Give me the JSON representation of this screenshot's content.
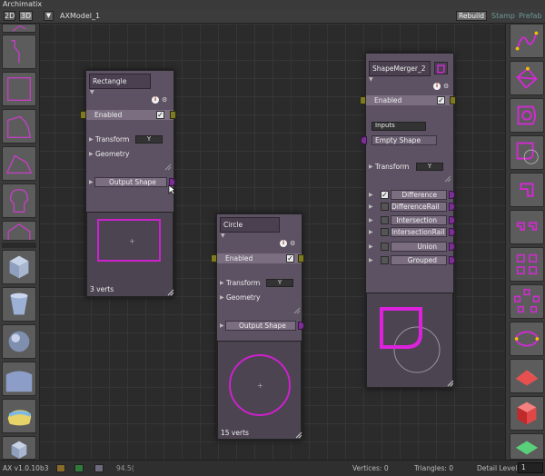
{
  "window_title": "Archimatix",
  "toolbar": {
    "btn_2d": "2D",
    "btn_3d": "3D",
    "dropdown_arrow": "▼",
    "model_name": "AXModel_1",
    "rebuild": "Rebuild",
    "stamp": "Stamp",
    "prefab": "Prefab"
  },
  "nodes": {
    "rectangle": {
      "title": "Rectangle",
      "enabled": "Enabled",
      "transform": "Transform",
      "transform_sel": "Y",
      "geometry": "Geometry",
      "output": "Output Shape",
      "verts": "3 verts"
    },
    "circle": {
      "title": "Circle",
      "enabled": "Enabled",
      "transform": "Transform",
      "transform_sel": "Y",
      "geometry": "Geometry",
      "output": "Output Shape",
      "verts": "15 verts"
    },
    "merger": {
      "title": "ShapeMerger_2",
      "enabled": "Enabled",
      "inputs": "Inputs",
      "empty_shape": "Empty Shape",
      "transform": "Transform",
      "transform_sel": "Y",
      "outputs": [
        "Difference",
        "DifferenceRail",
        "Intersection",
        "IntersectionRail",
        "Union",
        "Grouped"
      ]
    }
  },
  "status": {
    "version": "AX v1.0.10b3",
    "fps": "94.5(",
    "vertices": "Vertices: 0",
    "triangles": "Triangles: 0",
    "detail_label": "Detail Level",
    "detail_value": "1"
  },
  "colors": {
    "node_bg": "#5d5263",
    "accent_magenta": "#cc22cc",
    "plug_purple": "#7d2f96",
    "plug_olive": "#7d7a22"
  }
}
